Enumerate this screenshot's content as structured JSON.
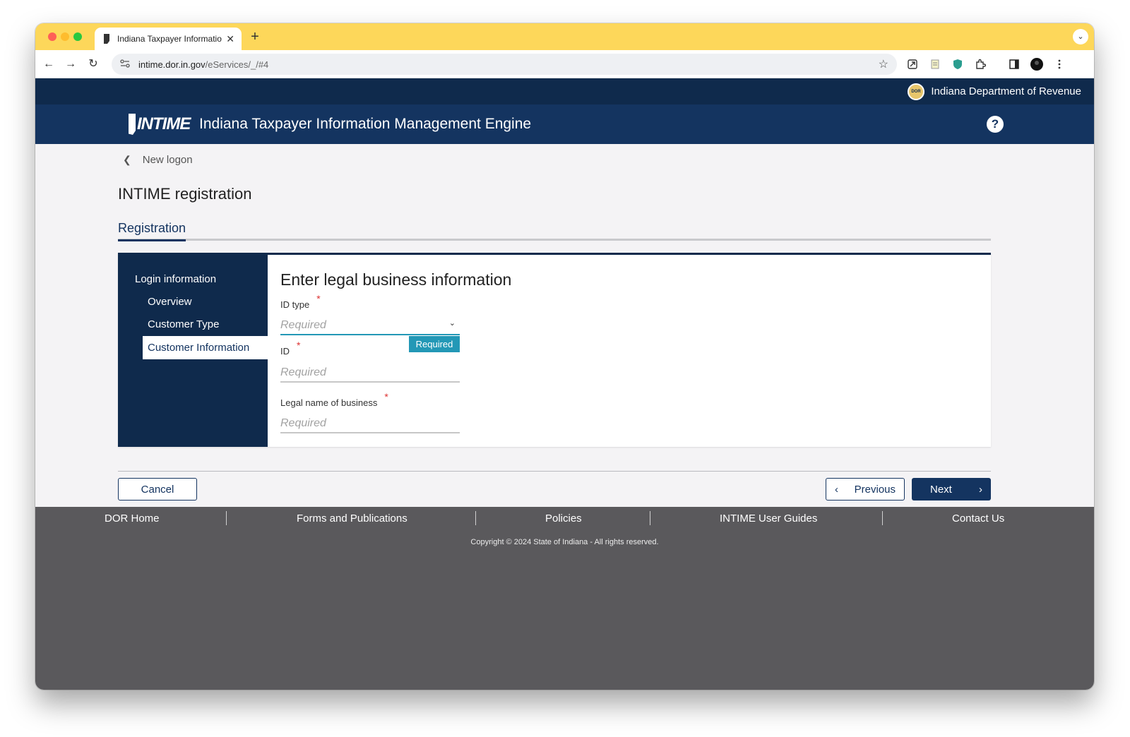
{
  "browser": {
    "tab_title": "Indiana Taxpayer Information",
    "tab_close": "✕",
    "new_tab": "+",
    "tablist": "⌄",
    "url_host": "intime.dor.in.gov",
    "url_path": "/eServices/_/#4",
    "back": "←",
    "forward": "→",
    "reload": "↻",
    "star": "☆"
  },
  "header": {
    "agency": "Indiana Department of Revenue",
    "seal_text": "DOR",
    "logo_text": "INTIME",
    "app_title": "Indiana Taxpayer Information Management Engine",
    "help": "?"
  },
  "breadcrumb": {
    "back_label": "New logon"
  },
  "page_title": "INTIME registration",
  "tabs": [
    {
      "label": "Registration",
      "active": true
    }
  ],
  "sidebar": {
    "group": "Login information",
    "items": [
      {
        "label": "Overview"
      },
      {
        "label": "Customer Type"
      },
      {
        "label": "Customer Information",
        "active": true
      }
    ]
  },
  "form": {
    "title": "Enter legal business information",
    "fields": [
      {
        "label": "ID type",
        "placeholder": "Required",
        "type": "select"
      },
      {
        "label": "ID",
        "placeholder": "Required"
      },
      {
        "label": "Legal name of business",
        "placeholder": "Required"
      }
    ],
    "required_marker": "*",
    "validation_badge": "Required"
  },
  "actions": {
    "cancel": "Cancel",
    "previous": "Previous",
    "next": "Next"
  },
  "footer": {
    "links": [
      "DOR Home",
      "Forms and Publications",
      "Policies",
      "INTIME User Guides",
      "Contact Us"
    ],
    "copyright": "Copyright © 2024 State of Indiana - All rights reserved."
  },
  "colors": {
    "title_bar": "#fdd75a",
    "navy": "#143460",
    "dark_navy": "#0f2a4c",
    "teal": "#2398b6",
    "footer": "#5a595c"
  }
}
